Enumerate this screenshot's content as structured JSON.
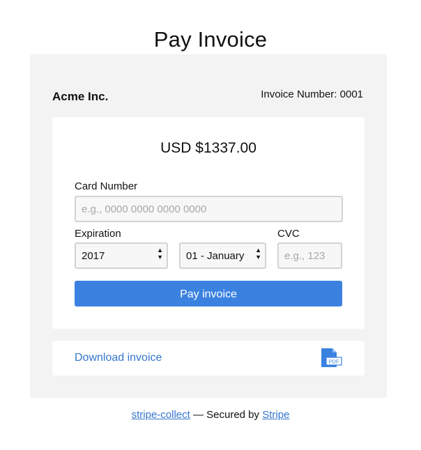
{
  "page": {
    "title": "Pay Invoice"
  },
  "invoice": {
    "company": "Acme Inc.",
    "number_text": "Invoice Number: 0001",
    "amount": "USD $1337.00"
  },
  "form": {
    "card_number_label": "Card Number",
    "card_number_placeholder": "e.g., 0000 0000 0000 0000",
    "card_number_value": "",
    "expiration_label": "Expiration",
    "year_value": "2017",
    "month_value": "01 - January",
    "cvc_label": "CVC",
    "cvc_placeholder": "e.g., 123",
    "cvc_value": "",
    "submit_label": "Pay invoice"
  },
  "download": {
    "link_text": "Download invoice",
    "icon": "pdf-file-icon",
    "icon_text": "PDF"
  },
  "footer": {
    "project_link": "stripe-collect",
    "separator_text": " — Secured by ",
    "stripe_link": "Stripe"
  },
  "colors": {
    "accent": "#3b82e0",
    "link": "#3476cc",
    "panel_bg": "#f3f3f3",
    "card_bg": "#ffffff"
  }
}
